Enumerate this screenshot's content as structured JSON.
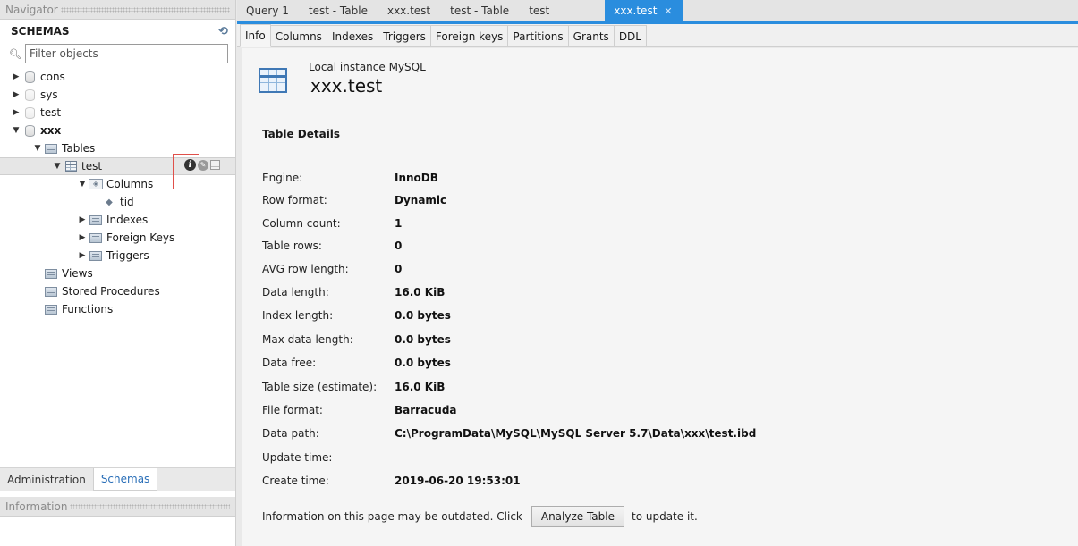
{
  "navigator": {
    "header": "Navigator",
    "schemas_label": "SCHEMAS",
    "filter_placeholder": "Filter objects",
    "tree": {
      "cons": "cons",
      "sys": "sys",
      "test": "test",
      "xxx": "xxx",
      "tables": "Tables",
      "table_test": "test",
      "columns": "Columns",
      "col_tid": "tid",
      "indexes": "Indexes",
      "foreign_keys": "Foreign Keys",
      "triggers": "Triggers",
      "views": "Views",
      "stored_procedures": "Stored Procedures",
      "functions": "Functions"
    },
    "bottom_tabs": [
      "Administration",
      "Schemas"
    ],
    "information_header": "Information"
  },
  "doc_tabs": [
    "Query 1",
    "test - Table",
    "xxx.test",
    "test - Table",
    "test",
    "xxx.test"
  ],
  "sub_tabs": [
    "Info",
    "Columns",
    "Indexes",
    "Triggers",
    "Foreign keys",
    "Partitions",
    "Grants",
    "DDL"
  ],
  "info": {
    "instance": "Local instance MySQL",
    "object_name": "xxx.test",
    "section_title": "Table Details",
    "details": [
      {
        "key": "Engine:",
        "value": "InnoDB"
      },
      {
        "key": "Row format:",
        "value": "Dynamic"
      },
      {
        "key": "Column count:",
        "value": "1"
      },
      {
        "key": "Table rows:",
        "value": "0"
      },
      {
        "key": "AVG row length:",
        "value": "0"
      },
      {
        "key": "Data length:",
        "value": "16.0 KiB"
      },
      {
        "key": "Index length:",
        "value": "0.0 bytes"
      },
      {
        "key": "Max data length:",
        "value": "0.0 bytes"
      },
      {
        "key": "Data free:",
        "value": "0.0 bytes"
      },
      {
        "key": "Table size (estimate):",
        "value": "16.0 KiB"
      },
      {
        "key": "File format:",
        "value": "Barracuda"
      },
      {
        "key": "Data path:",
        "value": "C:\\ProgramData\\MySQL\\MySQL Server 5.7\\Data\\xxx\\test.ibd"
      },
      {
        "key": "Update time:",
        "value": ""
      },
      {
        "key": "Create time:",
        "value": "2019-06-20 19:53:01"
      }
    ],
    "footer_prefix": "Information on this page may be outdated. Click",
    "analyze_button": "Analyze Table",
    "footer_suffix": "to update it."
  },
  "colors": {
    "accent": "#2a8dde",
    "highlight_box": "#e0504a",
    "schemas_tab_text": "#2a6fb8"
  },
  "icons": {
    "database": "database-icon",
    "table": "table-icon",
    "folder": "folder-icon",
    "info": "info-icon",
    "wrench": "wrench-icon",
    "grid": "table-data-icon",
    "refresh": "refresh-icon",
    "search": "search-icon",
    "close": "close-icon"
  }
}
